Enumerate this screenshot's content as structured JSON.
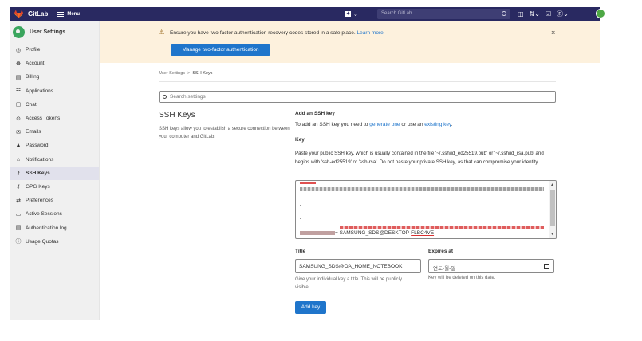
{
  "topbar": {
    "brand": "GitLab",
    "menu_label": "Menu",
    "search_placeholder": "Search GitLab",
    "colors": {
      "background": "#292961",
      "avatar": "#4ea845"
    }
  },
  "sidebar": {
    "title": "User Settings",
    "items": [
      {
        "label": "Profile",
        "icon": "profile-icon",
        "glyph": "◎",
        "active": false
      },
      {
        "label": "Account",
        "icon": "account-icon",
        "glyph": "☸",
        "active": false
      },
      {
        "label": "Billing",
        "icon": "billing-icon",
        "glyph": "▤",
        "active": false
      },
      {
        "label": "Applications",
        "icon": "applications-icon",
        "glyph": "☷",
        "active": false
      },
      {
        "label": "Chat",
        "icon": "chat-icon",
        "glyph": "▢",
        "active": false
      },
      {
        "label": "Access Tokens",
        "icon": "token-icon",
        "glyph": "⊙",
        "active": false
      },
      {
        "label": "Emails",
        "icon": "email-icon",
        "glyph": "✉",
        "active": false
      },
      {
        "label": "Password",
        "icon": "lock-icon",
        "glyph": "▲",
        "active": false
      },
      {
        "label": "Notifications",
        "icon": "bell-icon",
        "glyph": "⌂",
        "active": false
      },
      {
        "label": "SSH Keys",
        "icon": "key-icon",
        "glyph": "⚷",
        "active": true
      },
      {
        "label": "GPG Keys",
        "icon": "gpg-key-icon",
        "glyph": "⚷",
        "active": false
      },
      {
        "label": "Preferences",
        "icon": "preferences-icon",
        "glyph": "⇄",
        "active": false
      },
      {
        "label": "Active Sessions",
        "icon": "monitor-icon",
        "glyph": "▭",
        "active": false
      },
      {
        "label": "Authentication log",
        "icon": "log-icon",
        "glyph": "▤",
        "active": false
      },
      {
        "label": "Usage Quotas",
        "icon": "info-icon",
        "glyph": "ⓘ",
        "active": false
      }
    ]
  },
  "alert": {
    "message": "Ensure you have two-factor authentication recovery codes stored in a safe place.",
    "link": "Learn more.",
    "button": "Manage two-factor authentication",
    "close": "×"
  },
  "breadcrumb": {
    "parent": "User Settings",
    "separator": ">",
    "current": "SSH Keys"
  },
  "search_settings": {
    "placeholder": "Search settings"
  },
  "ssh": {
    "title": "SSH Keys",
    "description": "SSH keys allow you to establish a secure connection between your computer and GitLab."
  },
  "form": {
    "add_heading": "Add an SSH key",
    "add_text_pre": "To add an SSH key you need to ",
    "add_link1": "generate one",
    "add_text_mid": " or use an ",
    "add_link2": "existing key",
    "add_text_post": ".",
    "key_label": "Key",
    "key_help": "Paste your public SSH key, which is usually contained in the file '~/.ssh/id_ed25519.pub' or '~/.ssh/id_rsa.pub' and begins with 'ssh-ed25519' or 'ssh-rsa'. Do not paste your private SSH key, as that can compromise your identity.",
    "key_value_tail_1": "= SAMSUNG_SDS@DESKTOP-",
    "key_value_tail_2": "FLBC4VE",
    "title_label": "Title",
    "title_value": "SAMSUNG_SDS@OA_HOME_NOTEBOOK",
    "title_help": "Give your individual key a title. This will be publicly visible.",
    "expires_label": "Expires at",
    "expires_placeholder": "연도-월-일",
    "expires_help": "Key will be deleted on this date.",
    "submit": "Add key"
  }
}
